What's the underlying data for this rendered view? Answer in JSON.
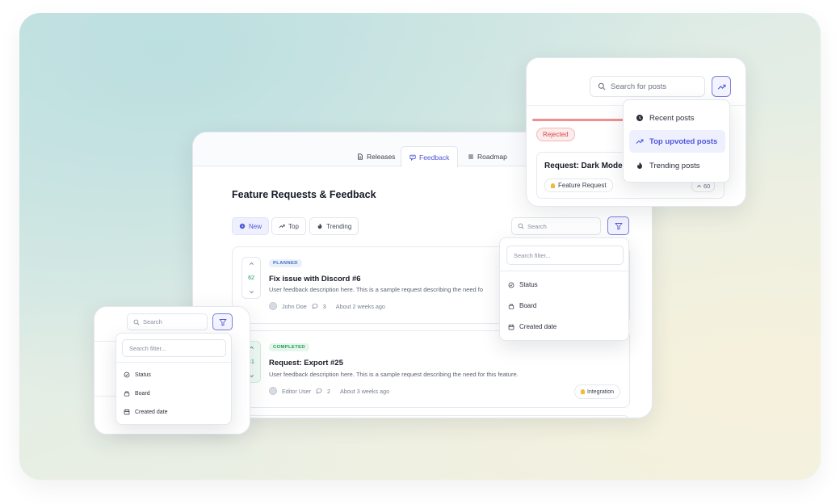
{
  "tabs": [
    {
      "label": "Releases",
      "icon": "document-icon"
    },
    {
      "label": "Feedback",
      "icon": "message-icon"
    },
    {
      "label": "Roadmap",
      "icon": "list-icon"
    }
  ],
  "page_title": "Feature Requests & Feedback",
  "sort_chips": [
    {
      "label": "New",
      "icon": "clock-icon"
    },
    {
      "label": "Top",
      "icon": "trending-icon"
    },
    {
      "label": "Trending",
      "icon": "flame-icon"
    }
  ],
  "search": {
    "placeholder": "Search"
  },
  "filter_menu": {
    "search_placeholder": "Search filter...",
    "items": [
      "Status",
      "Board",
      "Created date"
    ]
  },
  "posts": [
    {
      "status": "PLANNED",
      "votes": "62",
      "title": "Fix issue with Discord #6",
      "description": "User feedback description here. This is a sample request describing the need fo",
      "author": "John Doe",
      "comments": "3",
      "time": "About 2 weeks ago"
    },
    {
      "status": "COMPLETED",
      "votes": "41",
      "title": "Request: Export #25",
      "description": "User feedback description here. This is a sample request describing the need for this feature.",
      "author": "Editor User",
      "comments": "2",
      "time": "About 3 weeks ago",
      "tag": "Integration"
    }
  ],
  "top_right": {
    "search_placeholder": "Search for posts",
    "rejected_label": "Rejected",
    "post_title": "Request: Dark Mode #1",
    "post_tag": "Feature Request",
    "post_count": "60",
    "sort_menu": [
      "Recent posts",
      "Top upvoted posts",
      "Trending posts"
    ]
  },
  "colors": {
    "accent": "#4f56d9",
    "planned": "#3d6cc8",
    "completed": "#1f9a5a",
    "rejected": "#d34848"
  }
}
